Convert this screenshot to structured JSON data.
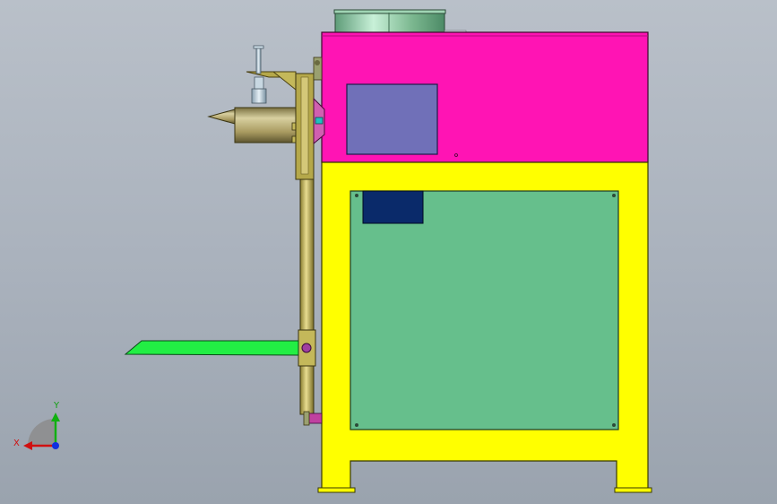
{
  "triad": {
    "x_label": "X",
    "y_label": "Y"
  },
  "colors": {
    "top_housing": "#ff14b4",
    "frame": "#ffff00",
    "panel": "#66bf8c",
    "display": "#7070b8",
    "label_plate": "#0a2a6a",
    "chute": "#22ee44",
    "arm": "#b5a84a",
    "funnel": "#a8a070",
    "drum": "#8cc8a0",
    "background": "#aab2bc"
  }
}
